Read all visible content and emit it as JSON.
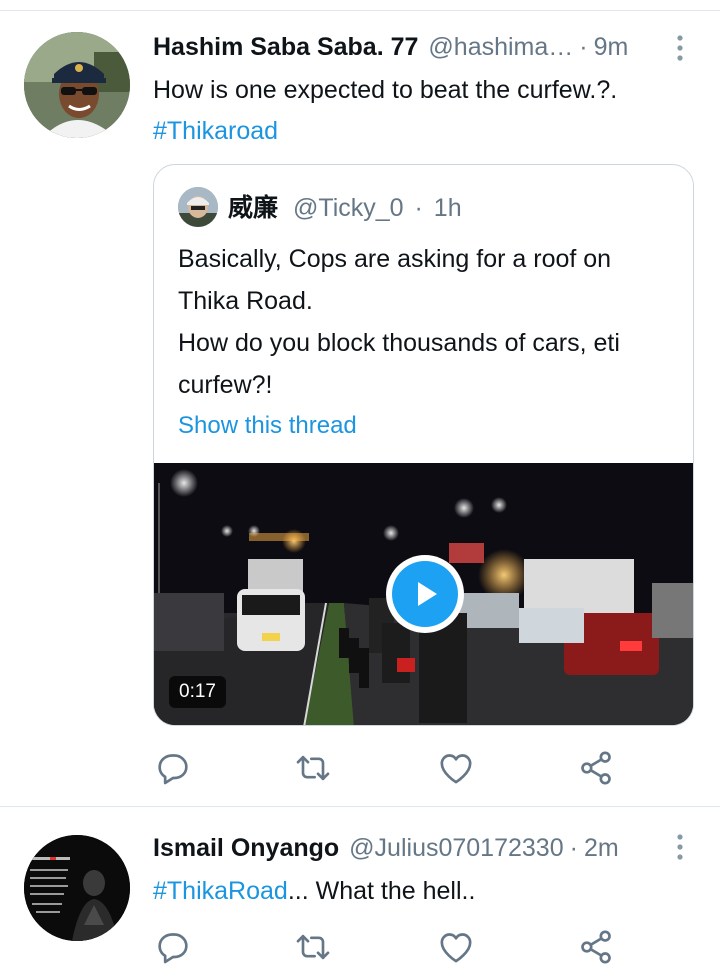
{
  "tweets": [
    {
      "author_name": "Hashim Saba Saba. 77",
      "handle": "@hashima…",
      "separator": "·",
      "time": "9m",
      "text_line1": "How is one expected to beat the curfew.?.",
      "hashtag": "#Thikaroad",
      "quoted": {
        "author_name": "威廉",
        "handle": "@Ticky_0",
        "separator": "·",
        "time": "1h",
        "text_line1": "Basically, Cops are asking for a roof on",
        "text_line2": "Thika Road.",
        "text_line3": "How do you block thousands of cars, eti",
        "text_line4": "curfew?!",
        "show_thread": "Show this thread",
        "video_duration": "0:17"
      }
    },
    {
      "author_name": "Ismail Onyango",
      "handle": "@Julius070172330",
      "separator": "·",
      "time": "2m",
      "hashtag": "#ThikaRoad",
      "text_suffix": "... What the hell.."
    }
  ],
  "icons": [
    "more-vertical-icon",
    "reply-icon",
    "retweet-icon",
    "like-icon",
    "share-icon",
    "play-icon"
  ],
  "colors": {
    "link": "#1b95e0",
    "secondary_text": "#657786",
    "border": "#ccd6dd",
    "play_button": "#1da1f2"
  }
}
